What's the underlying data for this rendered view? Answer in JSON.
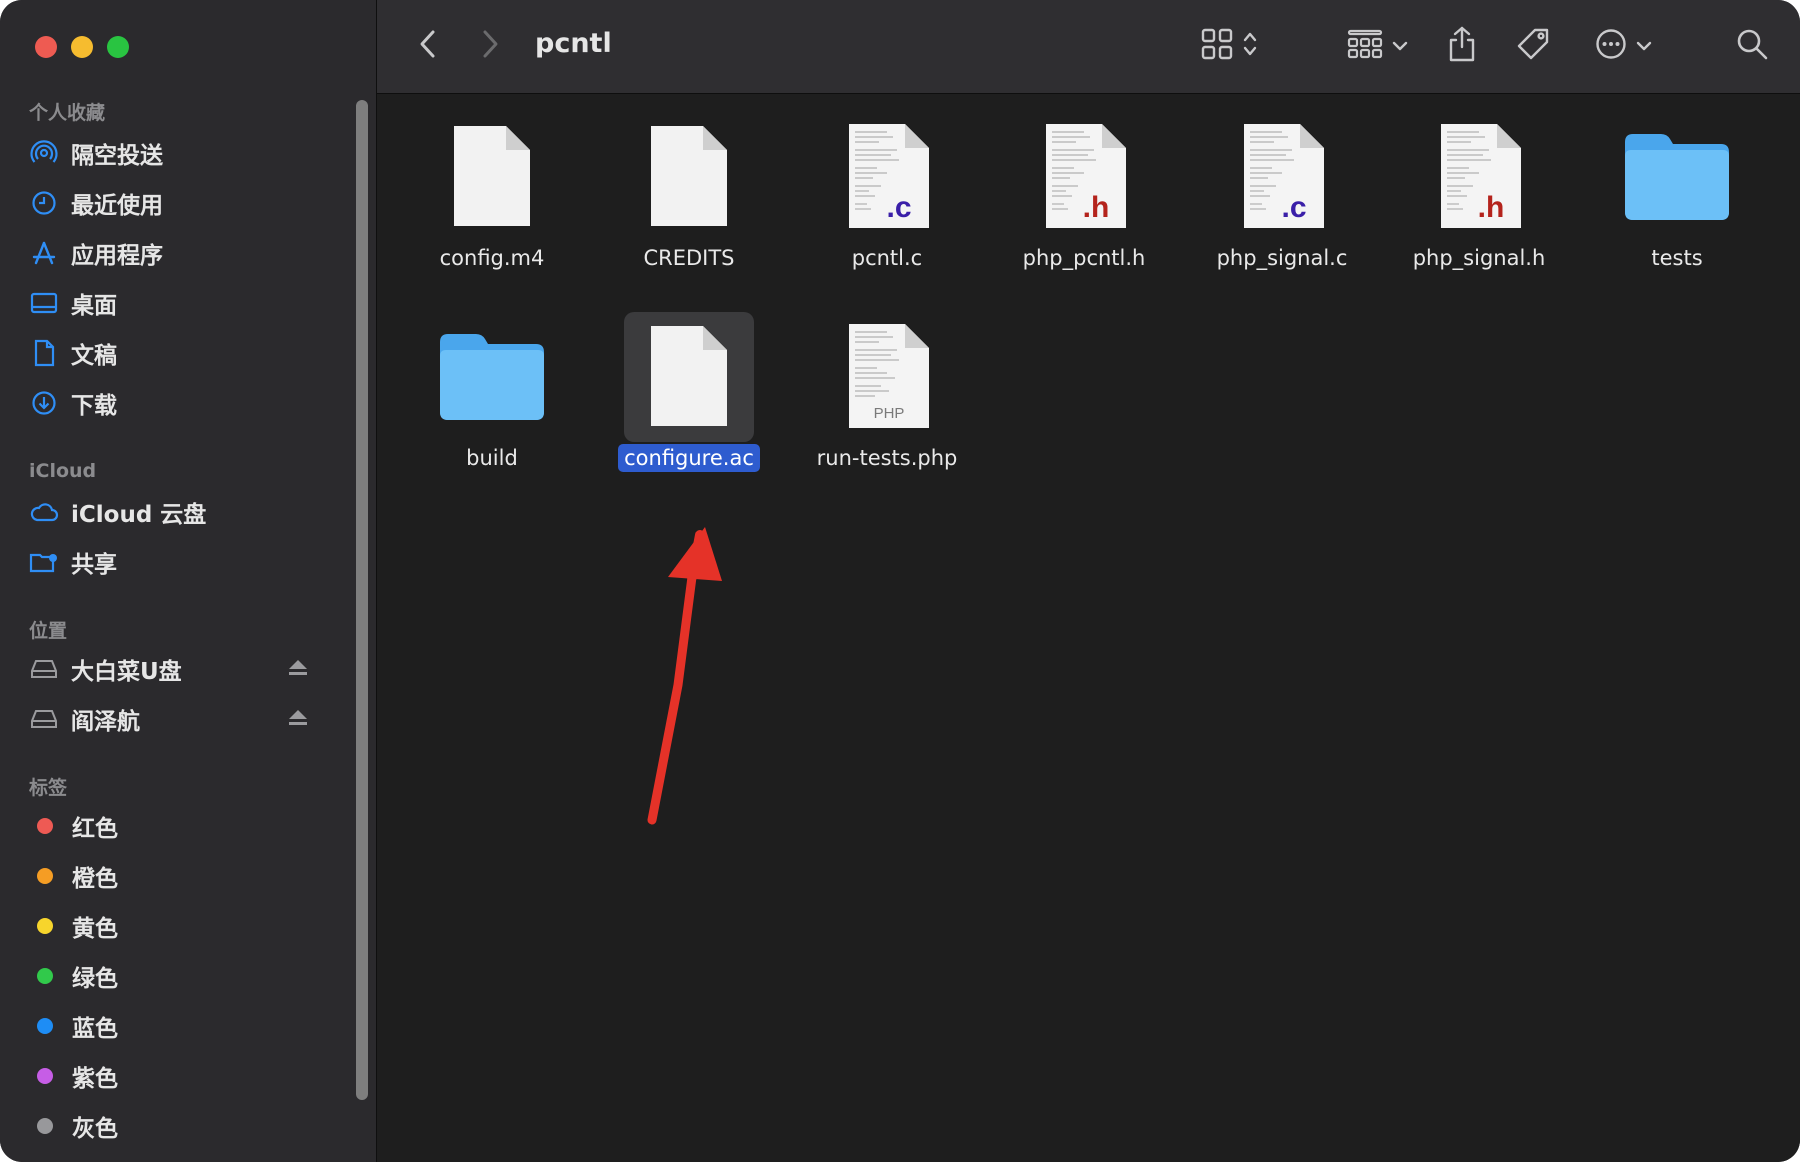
{
  "window": {
    "title": "pcntl"
  },
  "sidebar": {
    "favorites_title": "个人收藏",
    "favorites": [
      {
        "label": "隔空投送",
        "icon": "airdrop-icon"
      },
      {
        "label": "最近使用",
        "icon": "clock-icon"
      },
      {
        "label": "应用程序",
        "icon": "applications-icon"
      },
      {
        "label": "桌面",
        "icon": "desktop-icon"
      },
      {
        "label": "文稿",
        "icon": "document-icon"
      },
      {
        "label": "下载",
        "icon": "download-icon"
      }
    ],
    "icloud_title": "iCloud",
    "icloud": [
      {
        "label": "iCloud 云盘",
        "icon": "cloud-icon"
      },
      {
        "label": "共享",
        "icon": "shared-folder-icon"
      }
    ],
    "locations_title": "位置",
    "locations": [
      {
        "label": "大白菜U盘",
        "icon": "drive-icon",
        "ejectable": true
      },
      {
        "label": "阎泽航",
        "icon": "drive-icon",
        "ejectable": true
      }
    ],
    "tags_title": "标签",
    "tags": [
      {
        "label": "红色",
        "color": "#ee5a54"
      },
      {
        "label": "橙色",
        "color": "#f59d24"
      },
      {
        "label": "黄色",
        "color": "#f7d52c"
      },
      {
        "label": "绿色",
        "color": "#31c94b"
      },
      {
        "label": "蓝色",
        "color": "#1e8df5"
      },
      {
        "label": "紫色",
        "color": "#c65de6"
      },
      {
        "label": "灰色",
        "color": "#98989b"
      }
    ]
  },
  "toolbar": {
    "back_icon": "chevron-left-icon",
    "forward_icon": "chevron-right-icon",
    "view_icon": "grid-view-icon",
    "group_icon": "group-icon",
    "share_icon": "share-icon",
    "tag_icon": "tag-icon",
    "more_icon": "more-icon",
    "search_icon": "search-icon"
  },
  "files": [
    {
      "name": "config.m4",
      "kind": "blank"
    },
    {
      "name": "CREDITS",
      "kind": "blank"
    },
    {
      "name": "pcntl.c",
      "kind": "c",
      "ext": ".c"
    },
    {
      "name": "php_pcntl.h",
      "kind": "h",
      "ext": ".h"
    },
    {
      "name": "php_signal.c",
      "kind": "c",
      "ext": ".c"
    },
    {
      "name": "php_signal.h",
      "kind": "h",
      "ext": ".h"
    },
    {
      "name": "tests",
      "kind": "folder"
    },
    {
      "name": "build",
      "kind": "folder"
    },
    {
      "name": "configure.ac",
      "kind": "blank",
      "selected": true
    },
    {
      "name": "run-tests.php",
      "kind": "php",
      "ext": "PHP"
    }
  ],
  "colors": {
    "accent": "#2e5ccf",
    "arrow": "#e53228",
    "folder": "#5fb7f5"
  }
}
